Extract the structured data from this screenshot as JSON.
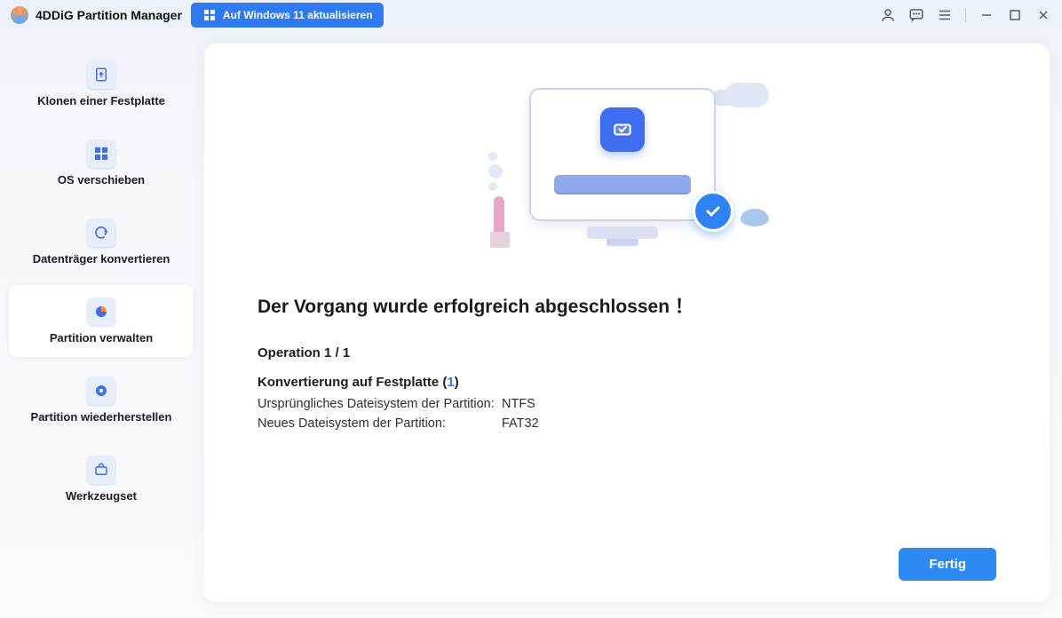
{
  "titlebar": {
    "app_title": "4DDiG Partition Manager",
    "update_label": "Auf Windows 11 aktualisieren"
  },
  "sidebar": {
    "items": [
      {
        "label": "Klonen einer Festplatte",
        "icon": "clone-icon"
      },
      {
        "label": "OS verschieben",
        "icon": "migrate-os-icon"
      },
      {
        "label": "Datenträger konvertieren",
        "icon": "convert-disk-icon"
      },
      {
        "label": "Partition verwalten",
        "icon": "manage-partition-icon"
      },
      {
        "label": "Partition wiederherstellen",
        "icon": "recover-partition-icon"
      },
      {
        "label": "Werkzeugset",
        "icon": "toolkit-icon"
      }
    ],
    "active_index": 3
  },
  "main": {
    "success_title": "Der Vorgang wurde erfolgreich abgeschlossen ！",
    "operation_heading": "Operation 1 / 1",
    "conversion_prefix": "Konvertierung auf Festplatte (",
    "conversion_disk_number": "1",
    "conversion_suffix": ")",
    "details": [
      {
        "label": "Ursprüngliches Dateisystem der Partition:",
        "value": "NTFS"
      },
      {
        "label": "Neues Dateisystem der Partition:",
        "value": "FAT32"
      }
    ],
    "finish_label": "Fertig"
  },
  "colors": {
    "accent": "#2e7af3",
    "accent_light": "#2e8af3"
  }
}
